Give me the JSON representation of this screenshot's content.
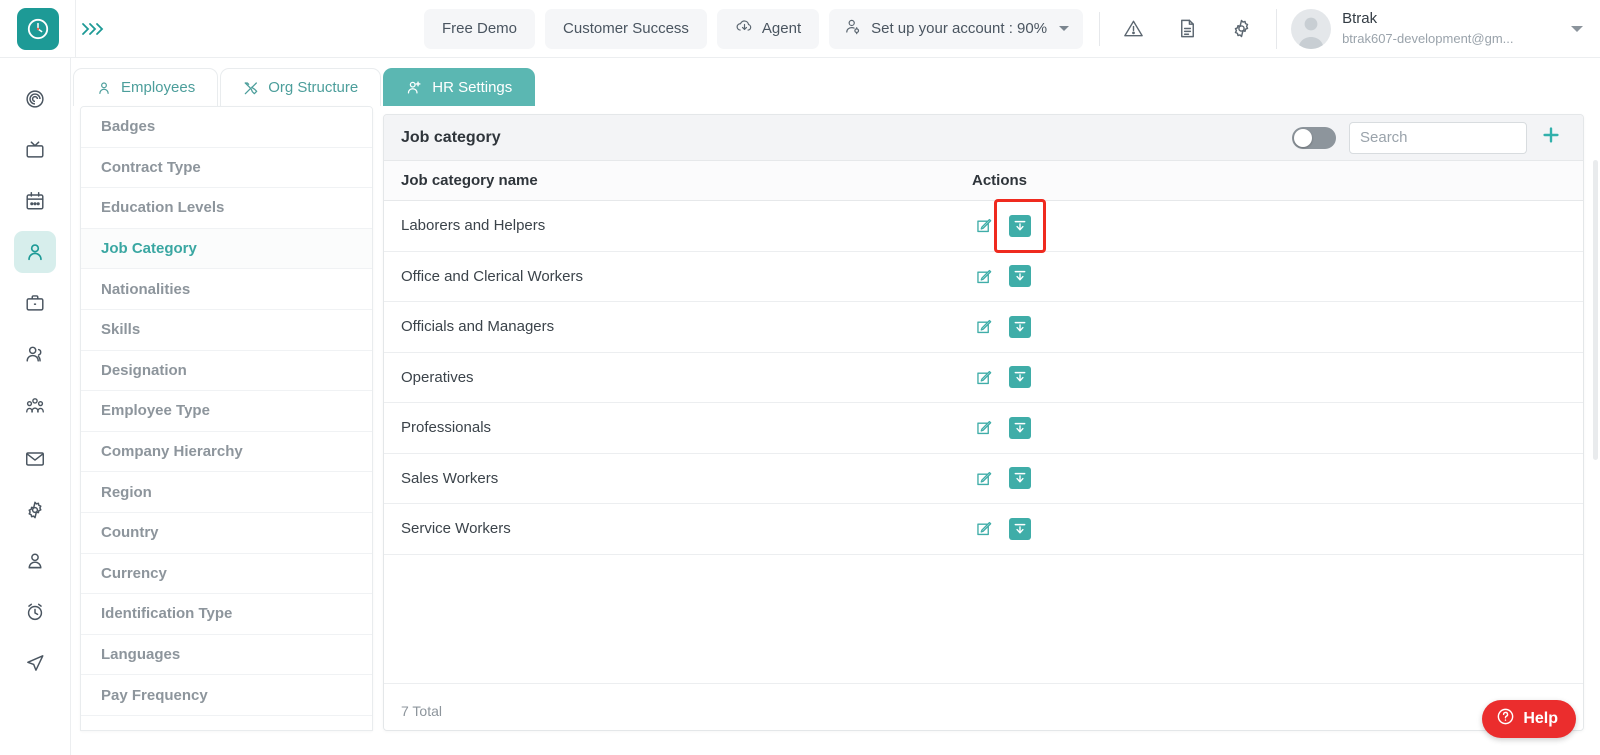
{
  "brand": {
    "accent": "#1d9a96",
    "tab_active": "#5bb7b2",
    "icon_teal": "#3fada8",
    "help_red": "#eb2d2d",
    "highlight_red": "#ef2a1f"
  },
  "topbar": {
    "logo_icon": "clock-dial-logo",
    "collapse_icon": "triple-chevron-right-icon",
    "buttons": [
      {
        "label": "Free Demo",
        "icon": null
      },
      {
        "label": "Customer Success",
        "icon": null
      },
      {
        "label": "Agent",
        "icon": "cloud-download-icon"
      }
    ],
    "account_setup": {
      "label": "Set up your account : 90%",
      "icon": "user-gear-icon",
      "caret": "caret-down-icon"
    },
    "icons": [
      {
        "name": "warning-triangle-icon"
      },
      {
        "name": "document-icon"
      },
      {
        "name": "gear-icon"
      }
    ],
    "profile": {
      "avatar_icon": "avatar-placeholder-icon",
      "name": "Btrak",
      "email": "btrak607-development@gm...",
      "caret": "caret-down-icon"
    }
  },
  "rail": {
    "items": [
      {
        "name": "target-icon",
        "active": false
      },
      {
        "name": "tv-icon",
        "active": false
      },
      {
        "name": "calendar-icon",
        "active": false
      },
      {
        "name": "person-icon",
        "active": true
      },
      {
        "name": "briefcase-icon",
        "active": false
      },
      {
        "name": "people-icon",
        "active": false
      },
      {
        "name": "org-group-icon",
        "active": false
      },
      {
        "name": "mail-icon",
        "active": false
      },
      {
        "name": "gear-icon",
        "active": false
      },
      {
        "name": "user-badge-icon",
        "active": false
      },
      {
        "name": "alarm-clock-icon",
        "active": false
      },
      {
        "name": "paper-plane-icon",
        "active": false
      }
    ]
  },
  "tabs": [
    {
      "label": "Employees",
      "icon": "person-icon",
      "active": false
    },
    {
      "label": "Org Structure",
      "icon": "tools-icon",
      "active": false
    },
    {
      "label": "HR Settings",
      "icon": "user-settings-icon",
      "active": true
    }
  ],
  "settings_list": {
    "items": [
      {
        "label": "Badges",
        "active": false
      },
      {
        "label": "Contract Type",
        "active": false
      },
      {
        "label": "Education Levels",
        "active": false
      },
      {
        "label": "Job Category",
        "active": true
      },
      {
        "label": "Nationalities",
        "active": false
      },
      {
        "label": "Skills",
        "active": false
      },
      {
        "label": "Designation",
        "active": false
      },
      {
        "label": "Employee Type",
        "active": false
      },
      {
        "label": "Company Hierarchy",
        "active": false
      },
      {
        "label": "Region",
        "active": false
      },
      {
        "label": "Country",
        "active": false
      },
      {
        "label": "Currency",
        "active": false
      },
      {
        "label": "Identification Type",
        "active": false
      },
      {
        "label": "Languages",
        "active": false
      },
      {
        "label": "Pay Frequency",
        "active": false
      }
    ]
  },
  "panel": {
    "title": "Job category",
    "toggle": {
      "name": "archived-toggle",
      "on": false
    },
    "search": {
      "value": "",
      "placeholder": "Search"
    },
    "add_button": {
      "icon": "plus-icon"
    },
    "columns": [
      "Job category name",
      "Actions"
    ],
    "rows": [
      {
        "name": "Laborers and Helpers",
        "highlighted": true
      },
      {
        "name": "Office and Clerical Workers",
        "highlighted": false
      },
      {
        "name": "Officials and Managers",
        "highlighted": false
      },
      {
        "name": "Operatives",
        "highlighted": false
      },
      {
        "name": "Professionals",
        "highlighted": false
      },
      {
        "name": "Sales Workers",
        "highlighted": false
      },
      {
        "name": "Service Workers",
        "highlighted": false
      }
    ],
    "row_actions": {
      "edit_icon": "edit-pencil-icon",
      "archive_icon": "archive-download-icon"
    },
    "footer_total": "7 Total"
  },
  "help": {
    "label": "Help",
    "icon": "question-circle-icon"
  }
}
